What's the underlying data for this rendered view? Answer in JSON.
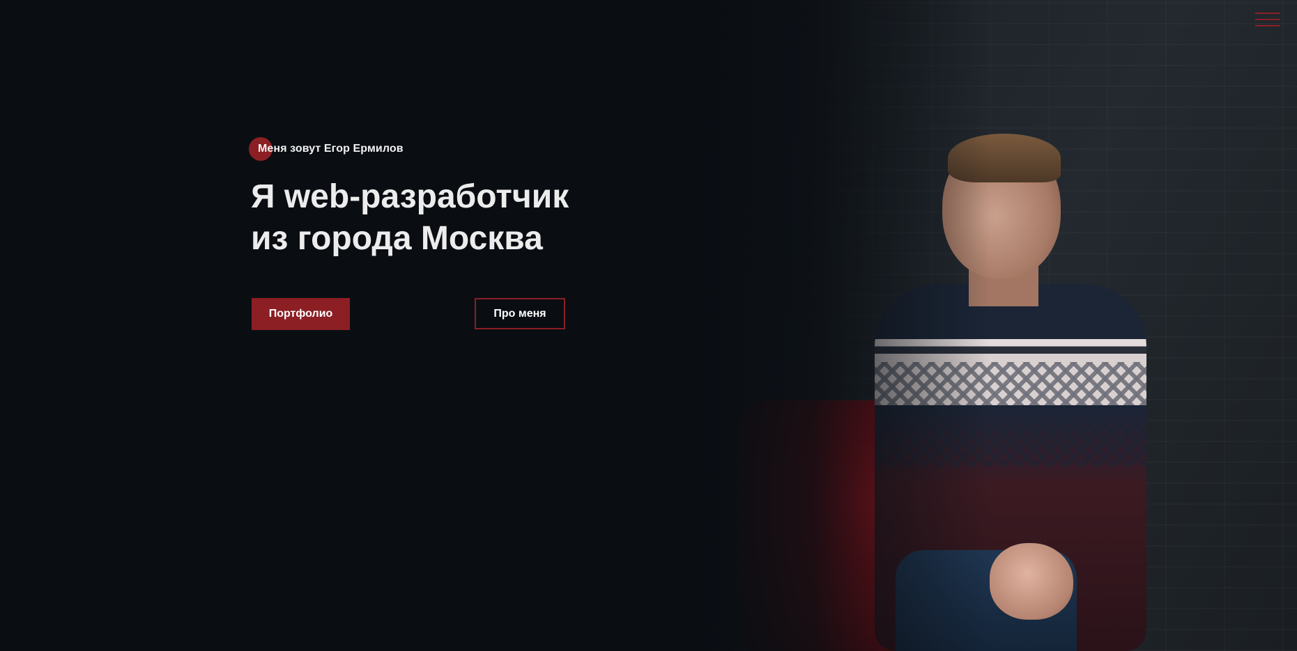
{
  "header": {
    "menu_icon": "hamburger-menu-icon"
  },
  "hero": {
    "intro": "Меня зовут Егор Ермилов",
    "title_line1": "Я web-разработчик",
    "title_line2": "из города Москва",
    "primary_button": "Портфолио",
    "secondary_button": "Про меня"
  },
  "colors": {
    "background": "#0a0e13",
    "accent": "#8b1f24",
    "text": "#ececec"
  }
}
